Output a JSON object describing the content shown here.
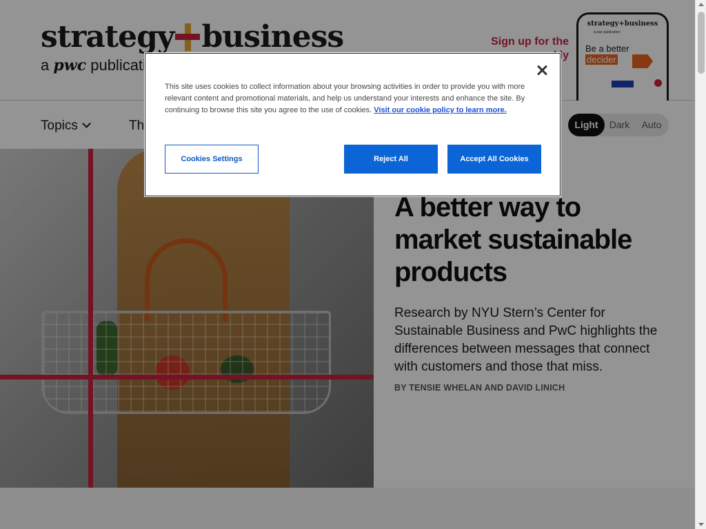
{
  "header": {
    "logo_left": "strategy",
    "logo_right": "business",
    "tagline_a": "a",
    "tagline_pwc": "pwc",
    "tagline_rest": "publication",
    "signup": "Sign up for the",
    "signup_line2": "weekly",
    "phone": {
      "logo": "strategy+business",
      "sub": "a pwc publication",
      "headline_1": "Be a better",
      "headline_2": "decider"
    }
  },
  "nav": {
    "topics": "Topics",
    "second": "The",
    "theme": {
      "light": "Light",
      "dark": "Dark",
      "auto": "Auto"
    }
  },
  "hero": {
    "title": "A better way to market sustainable products",
    "description": "Research by NYU Stern’s Center for Sustainable Business and PwC highlights the differences between messages that connect with customers and those that miss.",
    "byline": "BY TENSIE WHELAN AND DAVID LINICH"
  },
  "cookie": {
    "text": "This site uses cookies to collect information about your browsing activities in order to provide you with more relevant content and promotional materials, and help us understand your interests and enhance the site. By continuing to browse this site you agree to the use of cookies.",
    "link": "Visit our cookie policy to learn more.",
    "settings_label": "Cookies Settings",
    "reject_label": "Reject All",
    "accept_label": "Accept All Cookies"
  },
  "colors": {
    "brand_red": "#c8213f",
    "brand_yellow": "#e2a72e",
    "button_blue": "#0c65d6"
  }
}
